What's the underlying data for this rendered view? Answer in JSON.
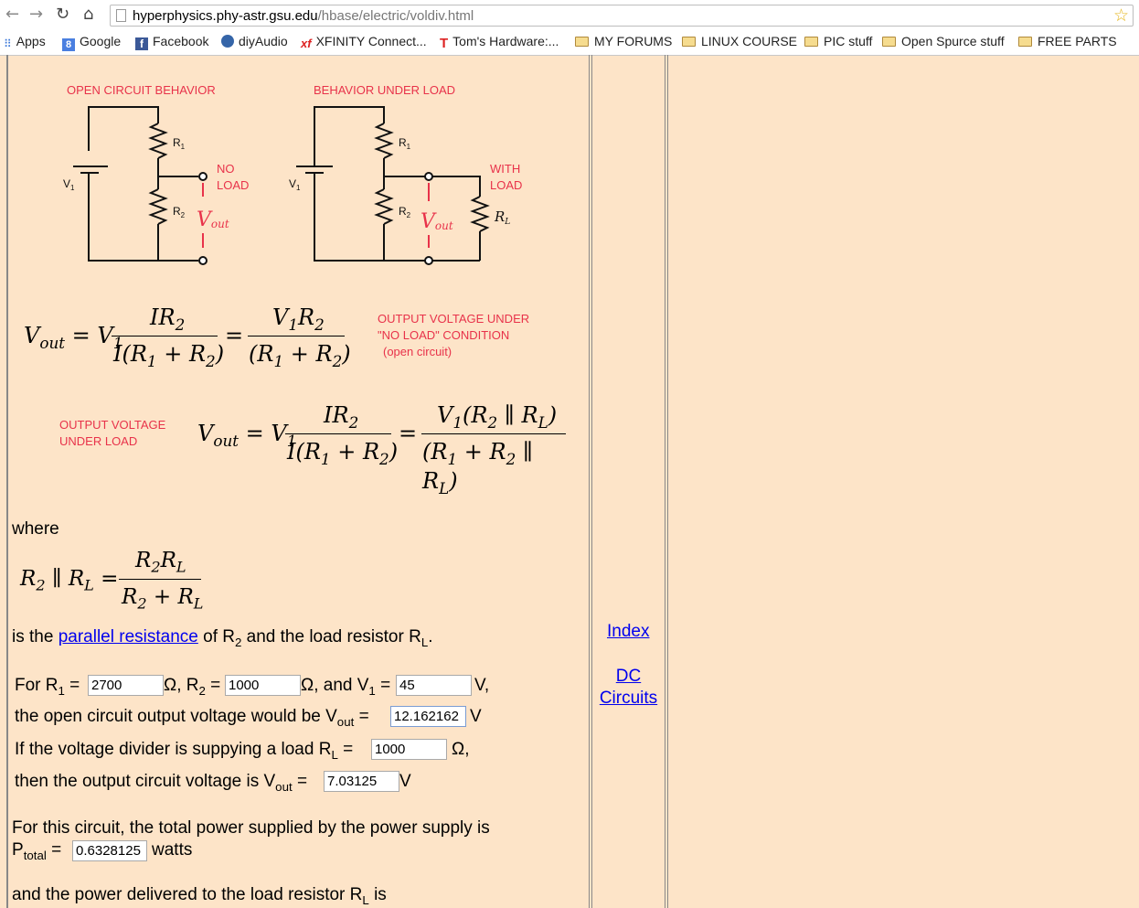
{
  "browser": {
    "back_icon": "back-arrow-icon",
    "url_host": "hyperphysics.phy-astr.gsu.edu",
    "url_path": "/hbase/electric/voldiv.html",
    "bookmarks": [
      {
        "label": "Apps",
        "icon": "apps-grid-icon"
      },
      {
        "label": "Google",
        "icon": "google-icon"
      },
      {
        "label": "Facebook",
        "icon": "facebook-icon"
      },
      {
        "label": "diyAudio",
        "icon": "diyaudio-icon"
      },
      {
        "label": "XFINITY Connect...",
        "icon": "xfinity-icon"
      },
      {
        "label": "Tom's Hardware:...",
        "icon": "toms-hardware-icon"
      },
      {
        "label": "MY FORUMS",
        "icon": "folder-icon"
      },
      {
        "label": "LINUX COURSE",
        "icon": "folder-icon"
      },
      {
        "label": "PIC stuff",
        "icon": "folder-icon"
      },
      {
        "label": "Open Spurce stuff",
        "icon": "folder-icon"
      },
      {
        "label": "FREE PARTS",
        "icon": "folder-icon"
      }
    ]
  },
  "diagrams": {
    "open_title": "OPEN CIRCUIT BEHAVIOR",
    "load_title": "BEHAVIOR UNDER LOAD",
    "no_load_1": "NO",
    "no_load_2": "LOAD",
    "with_load_1": "WITH",
    "with_load_2": "LOAD"
  },
  "formula_notes": {
    "open_1": "OUTPUT VOLTAGE UNDER",
    "open_2": "\"NO LOAD\" CONDITION",
    "open_3": "(open circuit)",
    "load_1": "OUTPUT VOLTAGE",
    "load_2": "UNDER LOAD"
  },
  "text": {
    "where": "where",
    "parallel_pre": "is the ",
    "parallel_link": "parallel resistance",
    "parallel_post": " of R",
    "parallel_post2": " and the load resistor R",
    "for_r1": "For R",
    "r2_label": "Ω, R",
    "v1_label": "Ω, and V",
    "v_unit": "V,",
    "open_line": "the open circuit output voltage would be V",
    "v_unit2": "V",
    "load_line": "If the voltage divider is suppying a load R",
    "ohm_comma": "Ω,",
    "then_line": "then the output circuit voltage is V",
    "v_unit3": "V",
    "power_line": "For this circuit, the total power supplied by the power supply is",
    "ptotal": "P",
    "total_sub": "total",
    "watts": "watts",
    "delivered_line": "and the power delivered to the load resistor R",
    "is": "is"
  },
  "inputs": {
    "r1": "2700",
    "r2": "1000",
    "v1": "45",
    "vout_open": "12.162162",
    "rl": "1000",
    "vout_load": "7.03125",
    "ptotal": "0.6328125"
  },
  "sidebar": {
    "index": "Index",
    "dc_1": "DC",
    "dc_2": "Circuits"
  }
}
